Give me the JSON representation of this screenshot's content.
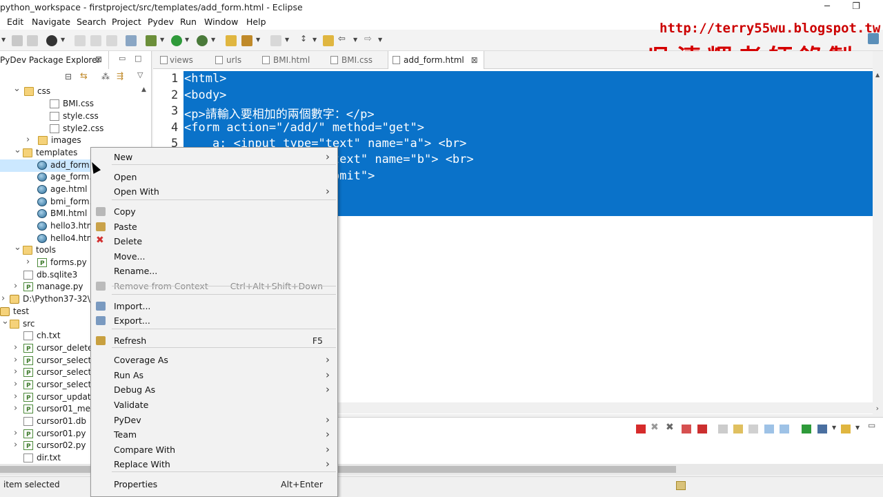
{
  "window": {
    "title": "python_workspace - firstproject/src/templates/add_form.html - Eclipse",
    "minimize_icon": "minimize-icon",
    "restore_icon": "restore-icon"
  },
  "menubar": [
    "Edit",
    "Navigate",
    "Search",
    "Project",
    "Pydev",
    "Run",
    "Window",
    "Help"
  ],
  "watermark": {
    "url": "http://terry55wu.blogspot.tw",
    "name": "吳清輝老師錄製"
  },
  "explorer": {
    "tab_label": "PyDev Package Explorer",
    "close": "⊠",
    "tree": [
      {
        "label": "css",
        "icon": "folder",
        "expanded": true
      },
      {
        "label": "BMI.css",
        "icon": "file"
      },
      {
        "label": "style.css",
        "icon": "file"
      },
      {
        "label": "style2.css",
        "icon": "file"
      },
      {
        "label": "images",
        "icon": "folder"
      },
      {
        "label": "templates",
        "icon": "folder",
        "expanded": true
      },
      {
        "label": "add_form.",
        "icon": "globe",
        "selected": true
      },
      {
        "label": "age_form.",
        "icon": "globe"
      },
      {
        "label": "age.html",
        "icon": "globe"
      },
      {
        "label": "bmi_form.",
        "icon": "globe"
      },
      {
        "label": "BMI.html",
        "icon": "globe"
      },
      {
        "label": "hello3.htm",
        "icon": "globe"
      },
      {
        "label": "hello4.htm",
        "icon": "globe"
      },
      {
        "label": "tools",
        "icon": "folder",
        "expanded": true
      },
      {
        "label": "forms.py",
        "icon": "py"
      },
      {
        "label": "db.sqlite3",
        "icon": "file"
      },
      {
        "label": "manage.py",
        "icon": "py"
      },
      {
        "label": "D:\\Python37-32\\",
        "icon": "proj"
      },
      {
        "label": "test",
        "icon": "proj",
        "expanded": true
      },
      {
        "label": "src",
        "icon": "folder",
        "expanded": true
      },
      {
        "label": "ch.txt",
        "icon": "file"
      },
      {
        "label": "cursor_delete",
        "icon": "py"
      },
      {
        "label": "cursor_selectE",
        "icon": "py"
      },
      {
        "label": "cursor_select組",
        "icon": "py"
      },
      {
        "label": "cursor_select組",
        "icon": "py"
      },
      {
        "label": "cursor_update",
        "icon": "py"
      },
      {
        "label": "cursor01_mer",
        "icon": "py"
      },
      {
        "label": "cursor01.db",
        "icon": "file"
      },
      {
        "label": "cursor01.py",
        "icon": "py"
      },
      {
        "label": "cursor02.py",
        "icon": "py"
      },
      {
        "label": "dir.txt",
        "icon": "file"
      }
    ]
  },
  "editor": {
    "tabs": [
      {
        "label": "views",
        "active": false
      },
      {
        "label": "urls",
        "active": false
      },
      {
        "label": "BMI.html",
        "active": false
      },
      {
        "label": "BMI.css",
        "active": false
      },
      {
        "label": "add_form.html",
        "active": true,
        "close": "⊠"
      }
    ],
    "line_numbers": [
      "1",
      "2",
      "3",
      "4",
      "5"
    ],
    "code_lines": [
      "<html>",
      "<body>",
      "<p>請輸入要相加的兩個數字：</p>",
      "<form action=\"/add/\" method=\"get\">",
      "    a: <input type=\"text\" name=\"a\"> <br>",
      "                    \"text\" name=\"b\"> <br>",
      "                     bmit\">"
    ]
  },
  "status": {
    "text": "item selected"
  },
  "context_menu": {
    "items": [
      {
        "label": "New",
        "submenu": true
      },
      {
        "label": "Open"
      },
      {
        "label": "Open With",
        "submenu": true
      },
      {
        "label": "Copy",
        "icon": "copy-icon"
      },
      {
        "label": "Paste",
        "icon": "paste-icon"
      },
      {
        "label": "Delete",
        "icon": "delete-icon"
      },
      {
        "label": "Move..."
      },
      {
        "label": "Rename..."
      },
      {
        "label": "Remove from Context",
        "shortcut": "Ctrl+Alt+Shift+Down",
        "disabled": true,
        "icon": "remove-context-icon"
      },
      {
        "label": "Import...",
        "icon": "import-icon"
      },
      {
        "label": "Export...",
        "icon": "export-icon"
      },
      {
        "label": "Refresh",
        "shortcut": "F5",
        "icon": "refresh-icon"
      },
      {
        "label": "Coverage As",
        "submenu": true
      },
      {
        "label": "Run As",
        "submenu": true
      },
      {
        "label": "Debug As",
        "submenu": true
      },
      {
        "label": "Validate"
      },
      {
        "label": "PyDev",
        "submenu": true
      },
      {
        "label": "Team",
        "submenu": true
      },
      {
        "label": "Compare With",
        "submenu": true
      },
      {
        "label": "Replace With",
        "submenu": true
      },
      {
        "label": "Properties",
        "shortcut": "Alt+Enter"
      }
    ],
    "submenu_arrow": "›"
  },
  "colors": {
    "selection": "#0a72c9",
    "watermark": "#d40000"
  }
}
